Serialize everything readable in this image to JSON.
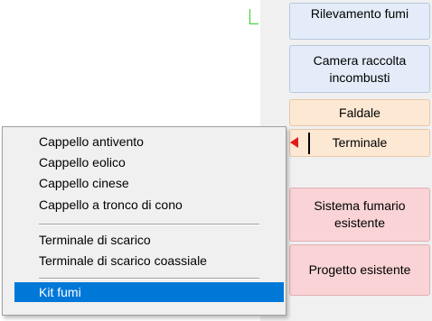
{
  "sidebar": {
    "buttons": [
      {
        "label": "Rilevamento fumi"
      },
      {
        "label": "Camera raccolta incombusti"
      },
      {
        "label": "Faldale"
      },
      {
        "label": "Terminale"
      },
      {
        "label": "Sistema fumario esistente"
      },
      {
        "label": "Progetto esistente"
      }
    ]
  },
  "context_menu": {
    "group1": [
      "Cappello antivento",
      "Cappello eolico",
      "Cappello cinese",
      "Cappello a tronco di cono"
    ],
    "group2": [
      "Terminale di scarico",
      "Terminale di scarico coassiale"
    ],
    "group3": [
      "Kit fumi"
    ],
    "selected_item": "Kit fumi"
  },
  "colors": {
    "panel_bg": "#f0f0f0",
    "blue_button": "#e3ecf8",
    "peach_button": "#fde8d4",
    "pink_button": "#f9d3d5",
    "selection": "#0078d7",
    "marker_red": "#e11b1b"
  }
}
